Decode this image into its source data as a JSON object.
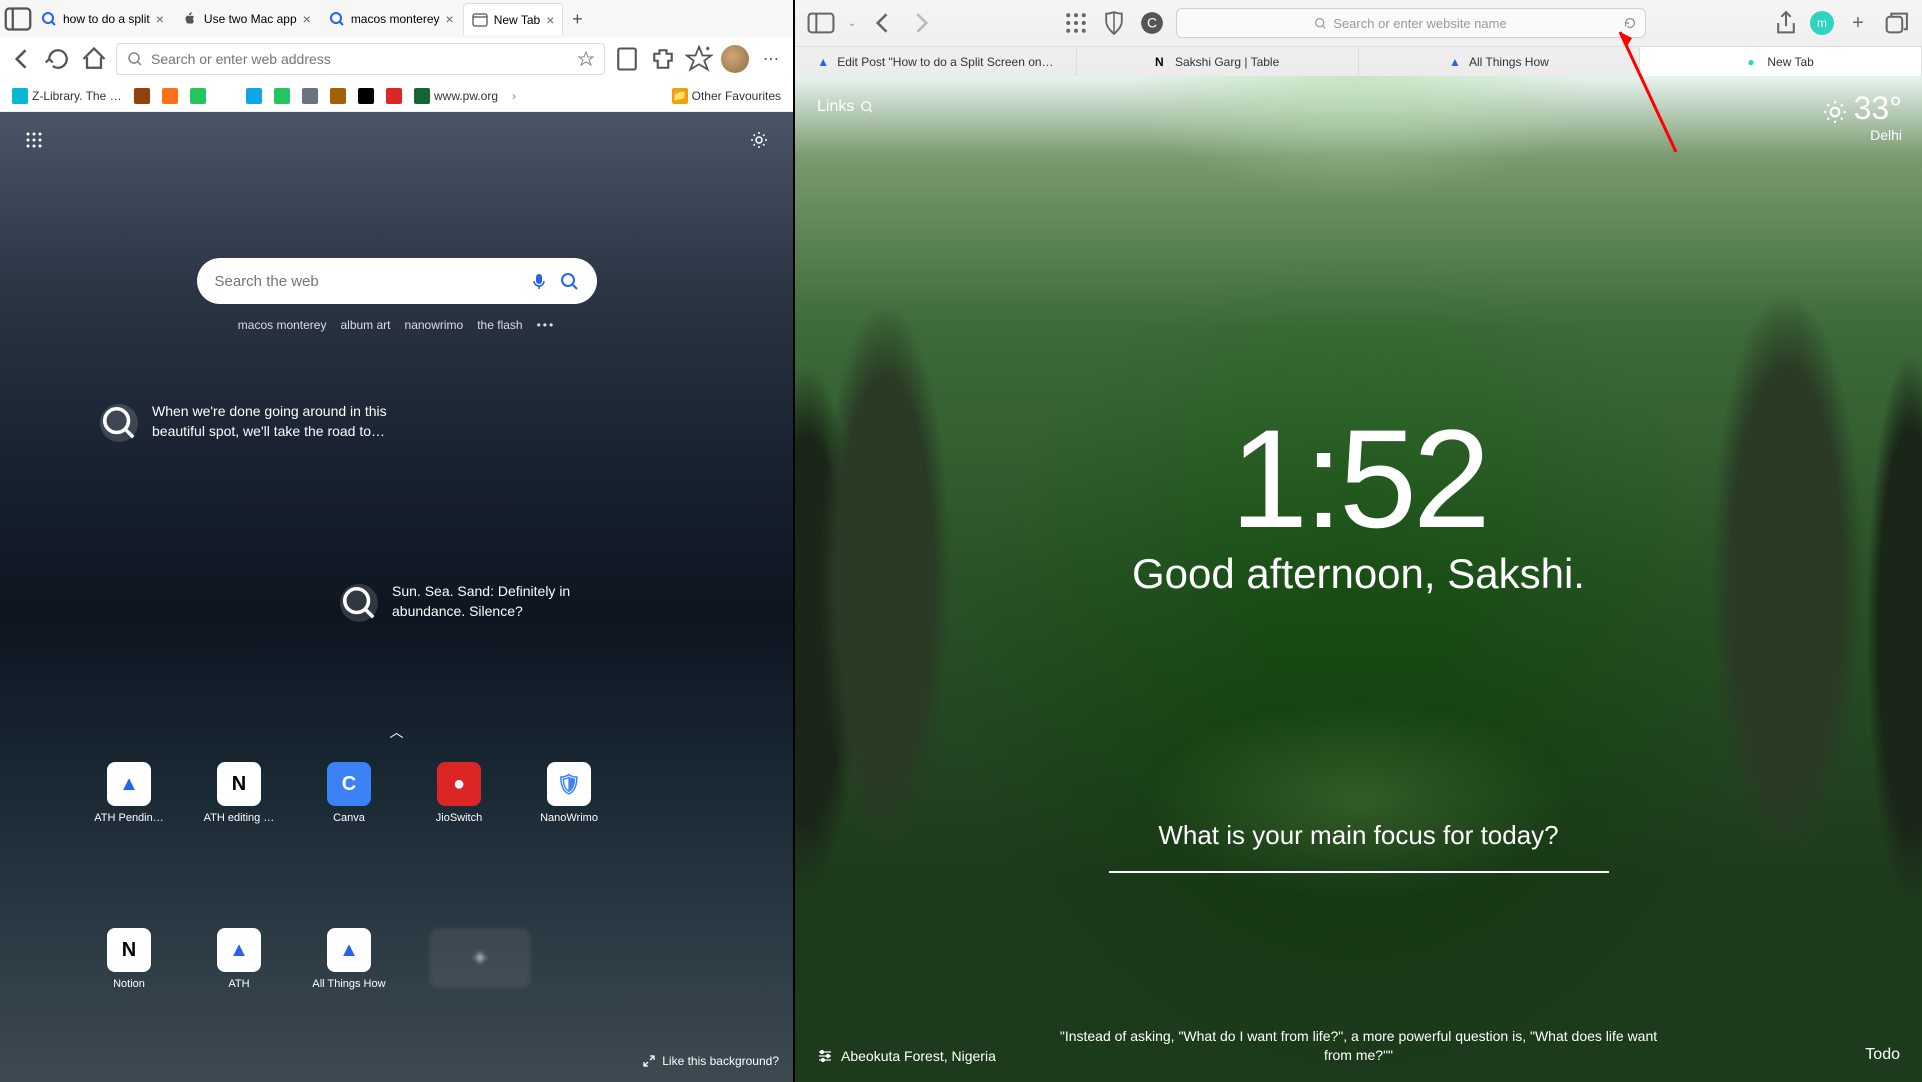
{
  "left": {
    "tabs": [
      {
        "label": "how to do a split",
        "icon": "search-blue"
      },
      {
        "label": "Use two Mac app",
        "icon": "apple"
      },
      {
        "label": "macos monterey",
        "icon": "search-blue"
      },
      {
        "label": "New Tab",
        "icon": "edge",
        "active": true
      }
    ],
    "address_placeholder": "Search or enter web address",
    "bookmarks": [
      {
        "label": "Z-Library. The wo…",
        "color": "#06b6d4"
      },
      {
        "label": "",
        "color": "#92400e"
      },
      {
        "label": "",
        "color": "#f97316"
      },
      {
        "label": "",
        "color": "#22c55e"
      },
      {
        "label": "",
        "color": "#ffffff"
      },
      {
        "label": "",
        "color": "#0ea5e9"
      },
      {
        "label": "",
        "color": "#22c55e"
      },
      {
        "label": "",
        "color": "#6b7280"
      },
      {
        "label": "",
        "color": "#a16207"
      },
      {
        "label": "",
        "color": "#000000"
      },
      {
        "label": "",
        "color": "#dc2626"
      },
      {
        "label": "www.pw.org",
        "color": "#166534"
      }
    ],
    "other_favs": "Other Favourites",
    "search_placeholder": "Search the web",
    "quick_links": [
      "macos monterey",
      "album art",
      "nanowrimo",
      "the flash"
    ],
    "inspire1": "When we're done going around in this beautiful spot, we'll take the road to…",
    "inspire2": "Sun. Sea. Sand: Definitely in abundance. Silence?",
    "tiles": [
      {
        "label": "ATH Pendin…",
        "bg": "#ffffff",
        "glyph": "▲",
        "gc": "#2563eb"
      },
      {
        "label": "ATH editing …",
        "bg": "#ffffff",
        "glyph": "N",
        "gc": "#000000"
      },
      {
        "label": "Canva",
        "bg": "#3b82f6",
        "glyph": "C",
        "gc": "#ffffff"
      },
      {
        "label": "JioSwitch",
        "bg": "#dc2626",
        "glyph": "●",
        "gc": "#ffffff"
      },
      {
        "label": "NanoWrimo",
        "bg": "#ffffff",
        "glyph": "🛡",
        "gc": "#3b82f6"
      },
      {
        "label": "Notion",
        "bg": "#ffffff",
        "glyph": "N",
        "gc": "#000000"
      },
      {
        "label": "ATH",
        "bg": "#ffffff",
        "glyph": "▲",
        "gc": "#2563eb"
      },
      {
        "label": "All Things How",
        "bg": "#ffffff",
        "glyph": "▲",
        "gc": "#2563eb"
      }
    ],
    "bg_prompt": "Like this background?"
  },
  "right": {
    "address_placeholder": "Search or enter website name",
    "avatar_letter": "m",
    "tabs": [
      {
        "label": "Edit Post \"How to do a Split Screen on…",
        "icon": "▲",
        "ic": "#2563eb"
      },
      {
        "label": "Sakshi Garg | Table",
        "icon": "N",
        "ic": "#000000"
      },
      {
        "label": "All Things How",
        "icon": "▲",
        "ic": "#2563eb"
      },
      {
        "label": "New Tab",
        "icon": "●",
        "ic": "#2dd4bf",
        "active": true
      }
    ],
    "links_label": "Links",
    "temp": "33°",
    "city": "Delhi",
    "time": "1:52",
    "greeting": "Good afternoon, Sakshi.",
    "focus_q": "What is your main focus for today?",
    "location": "Abeokuta Forest, Nigeria",
    "quote": "\"Instead of asking, \"What do I want from life?\", a more powerful question is, \"What does life want from me?\"\"",
    "todo": "Todo"
  }
}
